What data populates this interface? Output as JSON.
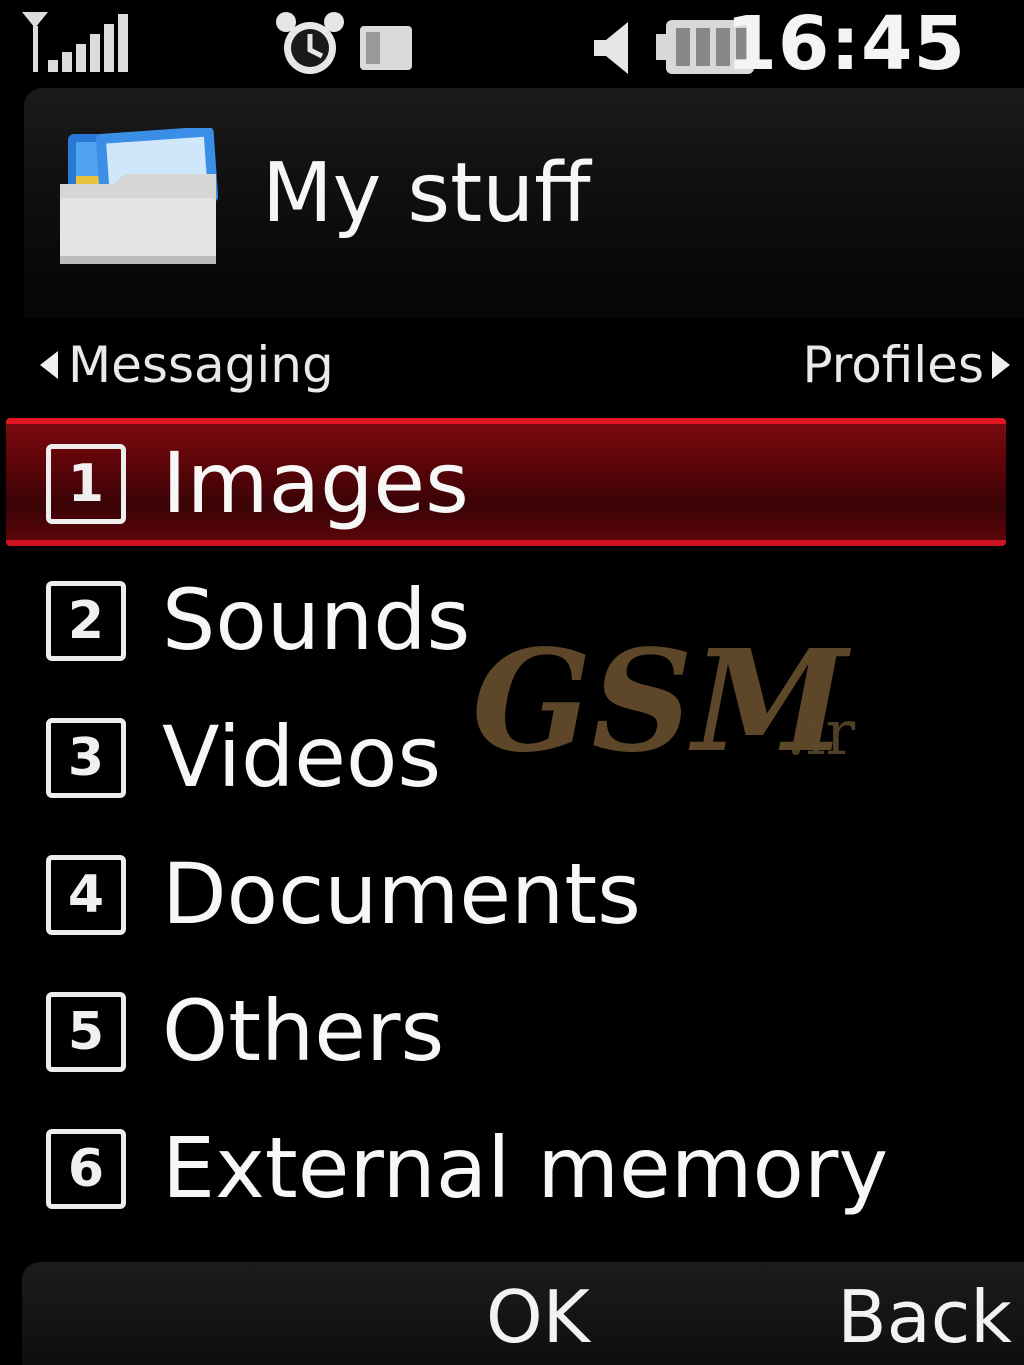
{
  "status_bar": {
    "time": "16:45",
    "icons": [
      "signal-icon",
      "alarm-icon",
      "message-icon",
      "speaker-icon",
      "battery-icon"
    ]
  },
  "header": {
    "title": "My stuff",
    "icon": "folder-icon"
  },
  "nav": {
    "prev_label": "Messaging",
    "next_label": "Profiles"
  },
  "menu": {
    "selected_index": 0,
    "items": [
      {
        "number": "1",
        "label": "Images"
      },
      {
        "number": "2",
        "label": "Sounds"
      },
      {
        "number": "3",
        "label": "Videos"
      },
      {
        "number": "4",
        "label": "Documents"
      },
      {
        "number": "5",
        "label": "Others"
      },
      {
        "number": "6",
        "label": "External memory"
      }
    ]
  },
  "watermark": {
    "brand": "GSM",
    "suffix": ".ir"
  },
  "softkeys": {
    "ok_label": "OK",
    "back_label": "Back"
  },
  "colors": {
    "highlight_red": "#e11622",
    "highlight_fill": "#5c0509",
    "watermark_brown": "#6e5430"
  }
}
